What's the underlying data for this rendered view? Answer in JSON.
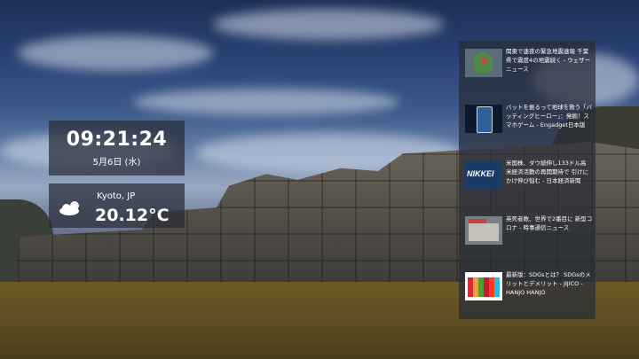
{
  "clock": {
    "time": "09:21:24",
    "date": "5月6日 (水)"
  },
  "weather": {
    "location": "Kyoto, JP",
    "temperature": "20.12°C",
    "icon": "partly-cloudy-icon"
  },
  "news": [
    {
      "thumb": "earthquake-map-thumbnail",
      "headline": "関東で速夜の緊急地震速報 千葉県で震度4の地震続く - ウェザーニュース"
    },
    {
      "thumb": "phone-game-thumbnail",
      "headline": "バットを振るって地球を救う「バッティングヒーロー」：発掘！スマホゲーム - Engadget日本版"
    },
    {
      "thumb": "nikkei-logo-thumbnail",
      "thumb_text": "NIKKEI",
      "headline": "米国株、ダウ続伸し133ドル高 米経済活動の再開期待で 引けにかけ伸び悩む - 日本経済新聞"
    },
    {
      "thumb": "news-photo-thumbnail",
      "headline": "英死者数、世界で2番目に 新型コロナ - 時事通信ニュース"
    },
    {
      "thumb": "sdgs-grid-thumbnail",
      "headline": "最新版：SDGsとは？ SDGsのメリットとデメリット - JIJICO - HANJO HANJO"
    }
  ]
}
